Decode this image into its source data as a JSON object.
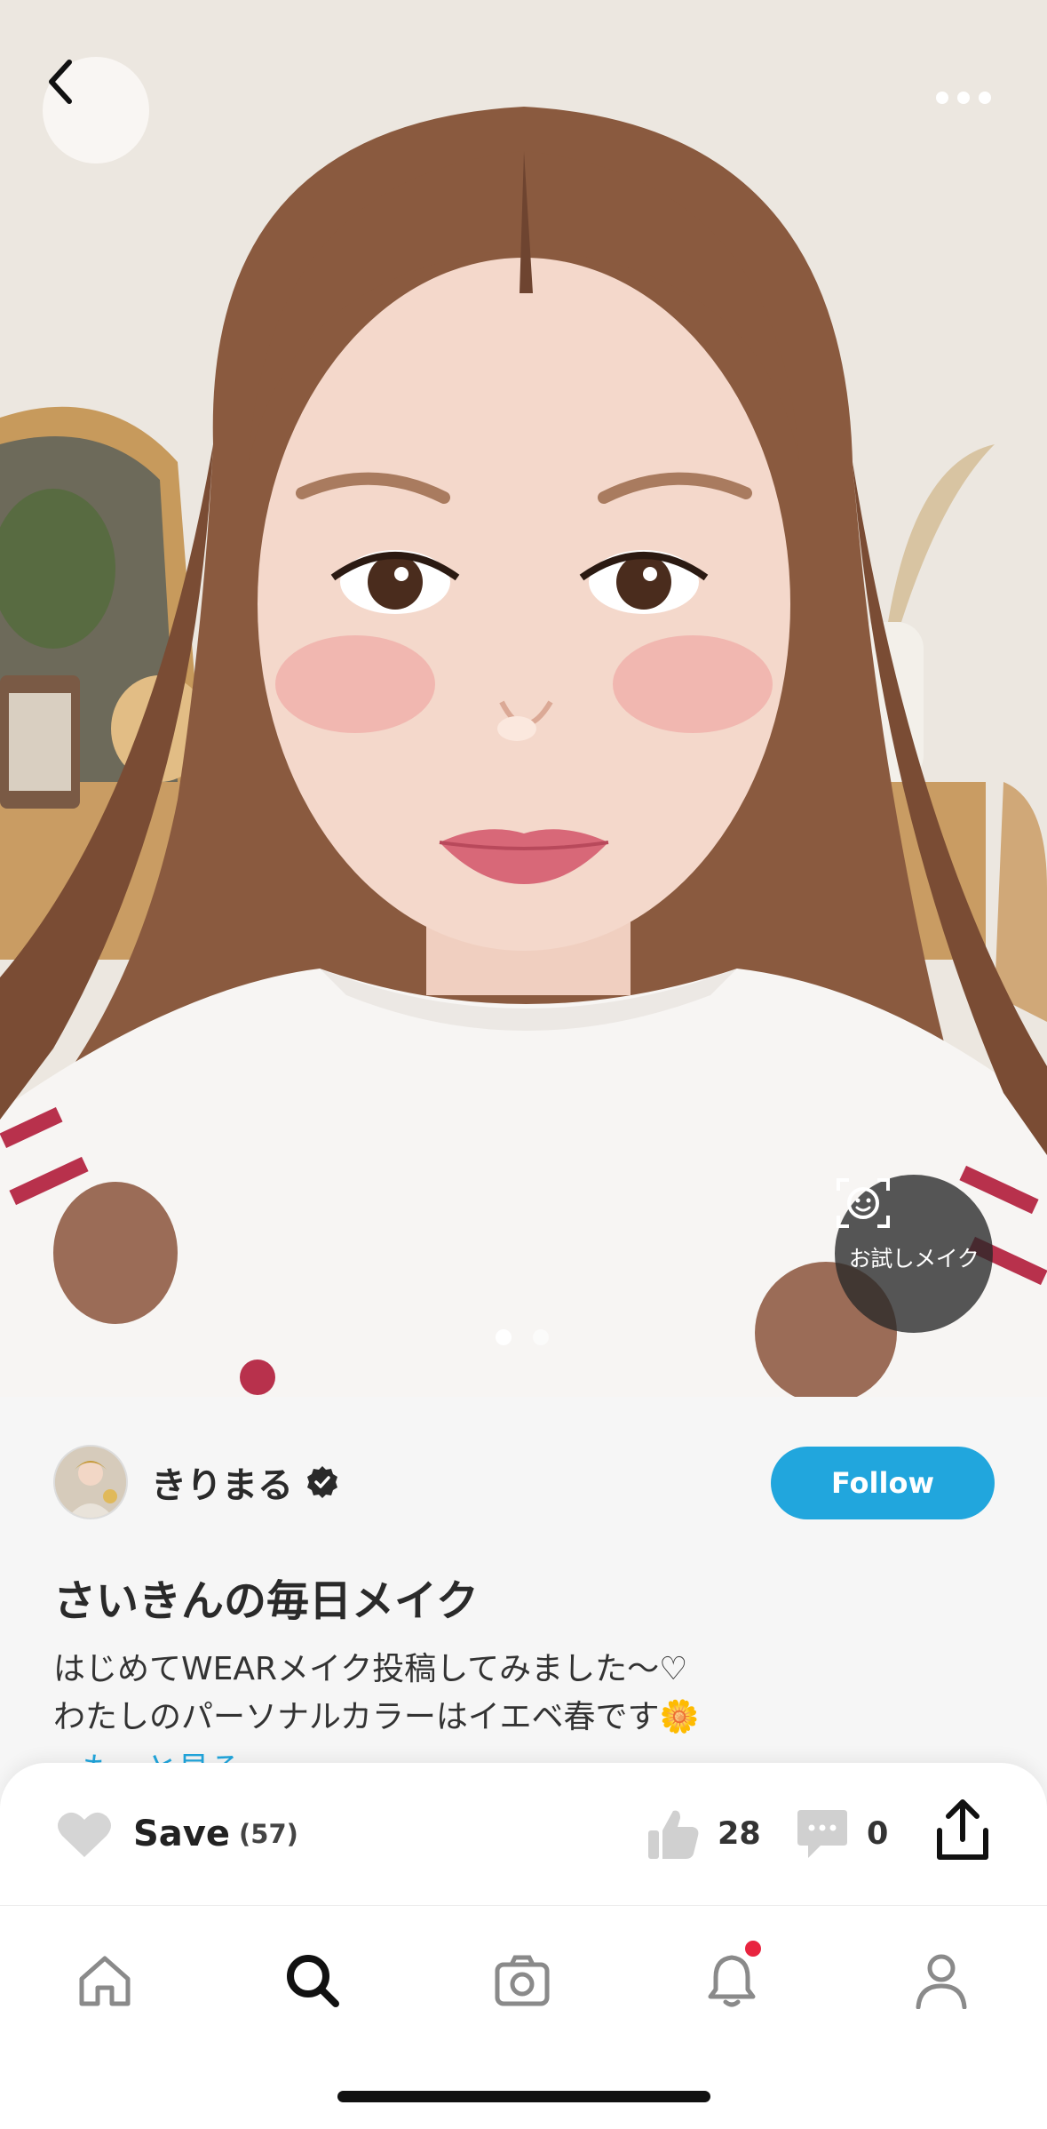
{
  "hero": {
    "tryon_label": "お試しメイク",
    "page_count": 2,
    "active_page": 1
  },
  "author": {
    "name": "きりまる",
    "verified": true,
    "follow_label": "Follow"
  },
  "post": {
    "title": "さいきんの毎日メイク",
    "body_lines": [
      "はじめてWEARメイク投稿してみました～♡",
      "わたしのパーソナルカラーはイエベ春です🌼"
    ],
    "see_more": "もっと見る"
  },
  "actions": {
    "save_label": "Save",
    "save_count": "(57)",
    "like_count": "28",
    "comment_count": "0"
  },
  "tabs": [
    {
      "name": "home",
      "icon": "home-icon"
    },
    {
      "name": "search",
      "icon": "search-icon",
      "active": true
    },
    {
      "name": "camera",
      "icon": "camera-icon"
    },
    {
      "name": "notifications",
      "icon": "bell-icon",
      "badge": true
    },
    {
      "name": "profile",
      "icon": "person-icon"
    }
  ],
  "colors": {
    "accent": "#21a6dd",
    "badge": "#e8243f"
  }
}
